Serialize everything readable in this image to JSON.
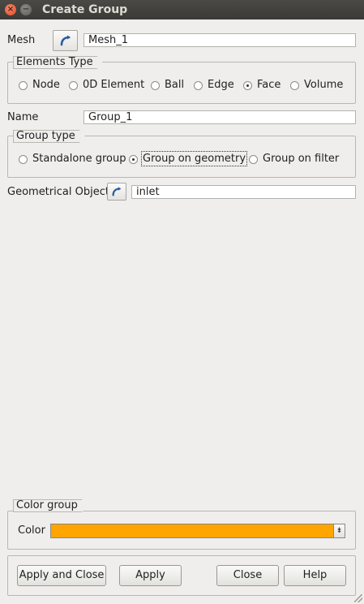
{
  "window": {
    "title": "Create Group",
    "close_glyph": "×",
    "minimize_glyph": "−"
  },
  "mesh": {
    "label": "Mesh",
    "value": "Mesh_1",
    "select_icon": "curve-arrow-icon"
  },
  "elements_type": {
    "title": "Elements Type",
    "options": [
      "Node",
      "0D Element",
      "Ball",
      "Edge",
      "Face",
      "Volume"
    ],
    "selected": "Face"
  },
  "name": {
    "label": "Name",
    "value": "Group_1"
  },
  "group_type": {
    "title": "Group type",
    "options": [
      "Standalone group",
      "Group on geometry",
      "Group on filter"
    ],
    "selected": "Group on geometry"
  },
  "geom": {
    "label": "Geometrical Object",
    "value": "inlet",
    "select_icon": "curve-arrow-icon"
  },
  "color_group": {
    "title": "Color group",
    "label": "Color",
    "color": "#ffa500",
    "drop_glyph": "⇟"
  },
  "buttons": {
    "apply_close": "Apply and Close",
    "apply": "Apply",
    "close": "Close",
    "help": "Help"
  },
  "colors": {
    "titlebar": "#3b3a36",
    "background": "#efeeec",
    "accent_close": "#dd4c24"
  }
}
